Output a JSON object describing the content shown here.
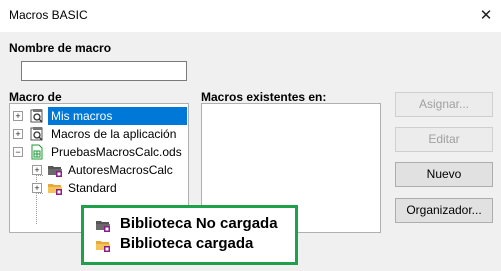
{
  "window": {
    "title": "Macros BASIC",
    "close_glyph": "✕"
  },
  "macro_name": {
    "label": "Nombre de macro",
    "value": ""
  },
  "macro_from": {
    "label": "Macro de",
    "tree": [
      {
        "label": "Mis macros",
        "icon": "basic-library-icon",
        "selected": true
      },
      {
        "label": "Macros de la aplicación",
        "icon": "basic-library-icon",
        "selected": false
      },
      {
        "label": "PruebasMacrosCalc.ods",
        "icon": "calc-document-icon",
        "selected": false
      },
      {
        "label": "AutoresMacrosCalc",
        "icon": "library-not-loaded-icon",
        "selected": false
      },
      {
        "label": "Standard",
        "icon": "library-loaded-icon",
        "selected": false
      }
    ]
  },
  "existing_macros": {
    "label": "Macros existentes en:"
  },
  "buttons": {
    "assign": "Asignar...",
    "edit": "Editar",
    "new": "Nuevo",
    "organizer": "Organizador..."
  },
  "legend": {
    "not_loaded": "Biblioteca No cargada",
    "loaded": "Biblioteca cargada"
  },
  "colors": {
    "selection": "#0078d7",
    "legend_border": "#1ea14a",
    "folder_yellow": "#f2c45a",
    "folder_dark": "#555555",
    "library_purple": "#8b1e8b",
    "calc_green": "#1e9a3a"
  }
}
